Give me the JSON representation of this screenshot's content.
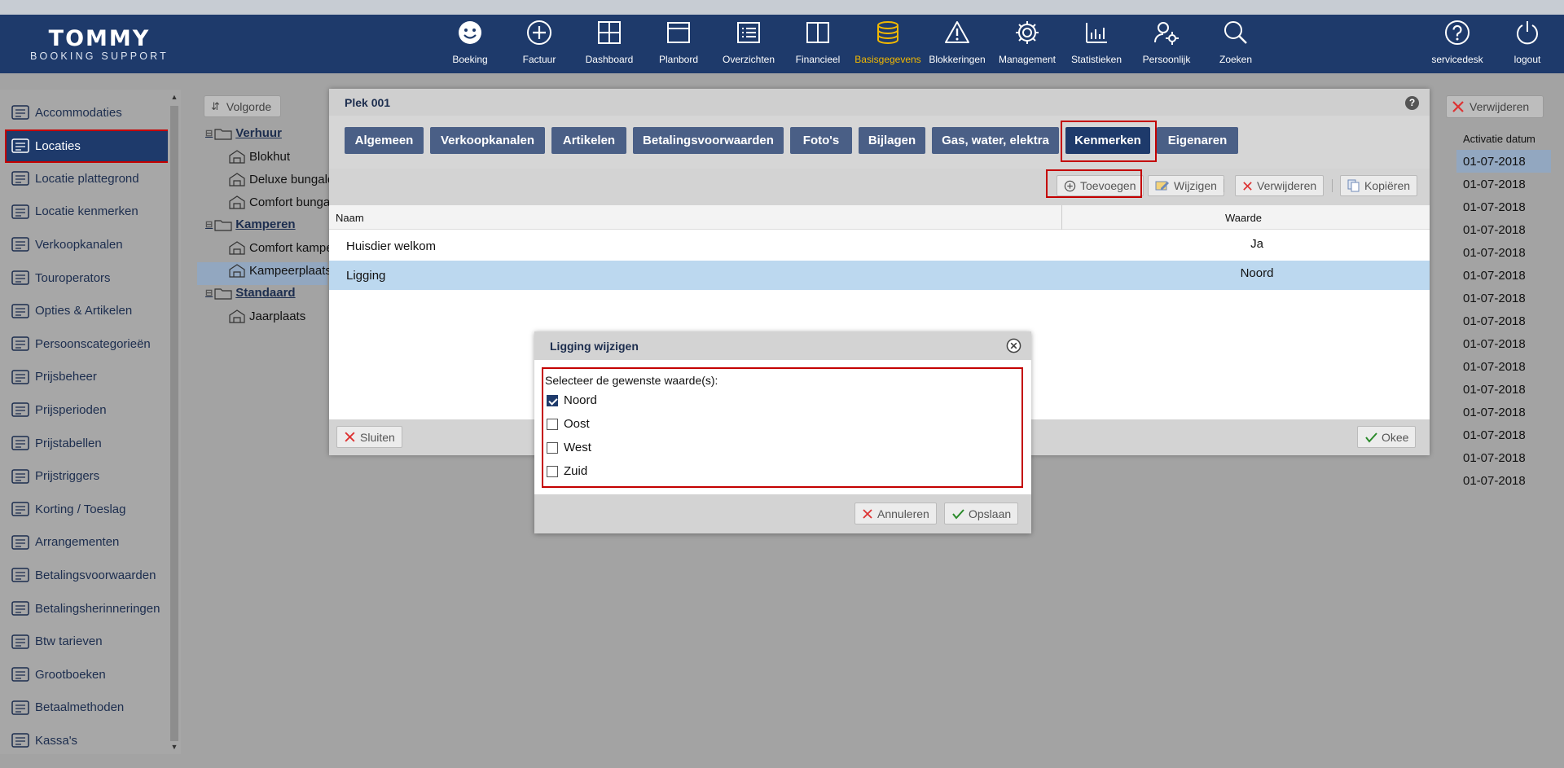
{
  "app": {
    "logo_line1": "TOMMY",
    "logo_line2": "BOOKING SUPPORT"
  },
  "nav": {
    "items": [
      {
        "label": "Boeking",
        "icon": "smiley-icon"
      },
      {
        "label": "Factuur",
        "icon": "plus-circle-icon"
      },
      {
        "label": "Dashboard",
        "icon": "grid-icon"
      },
      {
        "label": "Planbord",
        "icon": "window-icon"
      },
      {
        "label": "Overzichten",
        "icon": "list-icon"
      },
      {
        "label": "Financieel",
        "icon": "book-icon"
      },
      {
        "label": "Basisgegevens",
        "icon": "database-icon",
        "active": true
      },
      {
        "label": "Blokkeringen",
        "icon": "warning-icon"
      },
      {
        "label": "Management",
        "icon": "gear-icon"
      },
      {
        "label": "Statistieken",
        "icon": "bar-chart-icon"
      },
      {
        "label": "Persoonlijk",
        "icon": "user-gear-icon"
      },
      {
        "label": "Zoeken",
        "icon": "search-icon"
      }
    ],
    "right": [
      {
        "label": "servicedesk",
        "icon": "help-icon"
      },
      {
        "label": "logout",
        "icon": "power-icon"
      }
    ],
    "active_color": "#f2b800"
  },
  "sidebar": {
    "items": [
      {
        "label": "Accommodaties"
      },
      {
        "label": "Locaties",
        "active": true
      },
      {
        "label": "Locatie plattegrond"
      },
      {
        "label": "Locatie kenmerken"
      },
      {
        "label": "Verkoopkanalen"
      },
      {
        "label": "Touroperators"
      },
      {
        "label": "Opties & Artikelen"
      },
      {
        "label": "Persoonscategorieën"
      },
      {
        "label": "Prijsbeheer"
      },
      {
        "label": "Prijsperioden"
      },
      {
        "label": "Prijstabellen"
      },
      {
        "label": "Prijstriggers"
      },
      {
        "label": "Korting / Toeslag"
      },
      {
        "label": "Arrangementen"
      },
      {
        "label": "Betalingsvoorwaarden"
      },
      {
        "label": "Betalingsherinneringen"
      },
      {
        "label": "Btw tarieven"
      },
      {
        "label": "Grootboeken"
      },
      {
        "label": "Betaalmethoden"
      },
      {
        "label": "Kassa's"
      }
    ]
  },
  "tree": {
    "volgorde_label": "Volgorde",
    "groups": [
      {
        "label": "Verhuur",
        "children": [
          "Blokhut",
          "Deluxe bungalo",
          "Comfort bunga"
        ]
      },
      {
        "label": "Kamperen",
        "children": [
          "Comfort kampe",
          "Kampeerplaats"
        ]
      },
      {
        "label": "Standaard",
        "children": [
          "Jaarplaats"
        ]
      }
    ]
  },
  "background_list": {
    "verwijderen_label": "Verwijderen",
    "column_header": "Activatie datum",
    "rows": [
      "01-07-2018",
      "01-07-2018",
      "01-07-2018",
      "01-07-2018",
      "01-07-2018",
      "01-07-2018",
      "01-07-2018",
      "01-07-2018",
      "01-07-2018",
      "01-07-2018",
      "01-07-2018",
      "01-07-2018",
      "01-07-2018",
      "01-07-2018",
      "01-07-2018"
    ]
  },
  "dialog": {
    "title": "Plek 001",
    "help": "?",
    "tabs": [
      "Algemeen",
      "Verkoopkanalen",
      "Artikelen",
      "Betalingsvoorwaarden",
      "Foto's",
      "Bijlagen",
      "Gas, water, elektra",
      "Kenmerken",
      "Eigenaren"
    ],
    "active_tab": "Kenmerken",
    "toolbar": {
      "add": "Toevoegen",
      "edit": "Wijzigen",
      "delete": "Verwijderen",
      "copy": "Kopiëren"
    },
    "grid": {
      "col_name": "Naam",
      "col_value": "Waarde",
      "rows": [
        {
          "name": "Huisdier welkom",
          "value": "Ja"
        },
        {
          "name": "Ligging",
          "value": "Noord"
        }
      ]
    },
    "footer": {
      "close": "Sluiten",
      "ok": "Okee"
    }
  },
  "subdialog": {
    "title": "Ligging wijzigen",
    "prompt": "Selecteer de gewenste waarde(s):",
    "options": [
      {
        "label": "Noord",
        "checked": true
      },
      {
        "label": "Oost",
        "checked": false
      },
      {
        "label": "West",
        "checked": false
      },
      {
        "label": "Zuid",
        "checked": false
      }
    ],
    "cancel": "Annuleren",
    "save": "Opslaan"
  }
}
